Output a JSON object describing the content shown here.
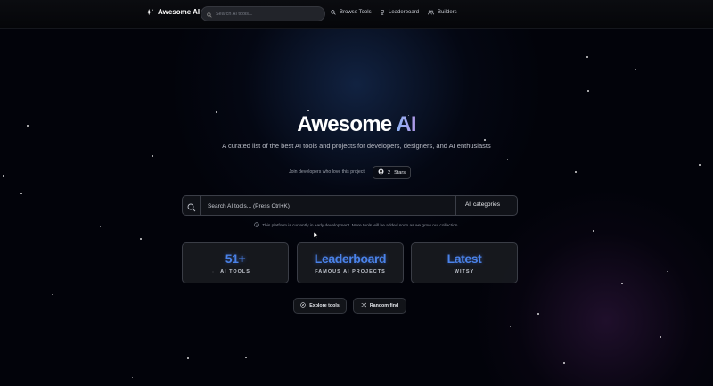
{
  "app": {
    "name": "Awesome AI"
  },
  "nav": {
    "search_placeholder": "Search AI tools...",
    "links": [
      {
        "label": "Browse Tools",
        "icon": "search-icon"
      },
      {
        "label": "Leaderboard",
        "icon": "trophy-icon"
      },
      {
        "label": "Builders",
        "icon": "users-icon"
      }
    ]
  },
  "hero": {
    "title_main": "Awesome",
    "title_accent": "AI",
    "subtitle": "A curated list of the best AI tools and projects for developers, designers, and AI enthusiasts",
    "join_text": "Join developers who love this project",
    "stars_count": "2",
    "stars_label": "Stars"
  },
  "search": {
    "placeholder": "Search AI tools... (Press Ctrl+K)",
    "category": "All categories"
  },
  "notice": "This platform is currently in early development. More tools will be added soon as we grow our collection.",
  "stats": [
    {
      "value": "51+",
      "label": "AI TOOLS"
    },
    {
      "value": "Leaderboard",
      "label": "FAMOUS AI PROJECTS"
    },
    {
      "value": "Latest",
      "label": "WITSY"
    }
  ],
  "actions": {
    "explore": "Explore tools",
    "random": "Random find"
  },
  "colors": {
    "accent_blue": "#4a82e8",
    "background": "#02030a"
  }
}
